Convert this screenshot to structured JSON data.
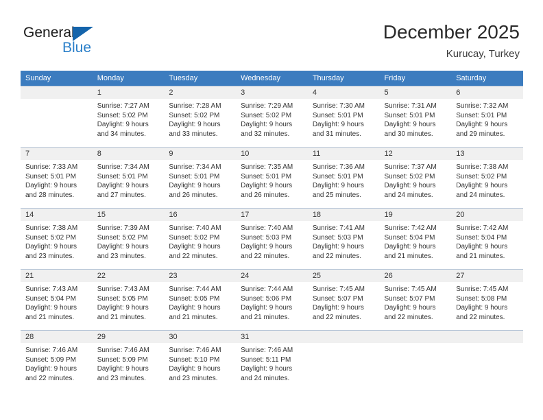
{
  "brand": {
    "name_part1": "General",
    "name_part2": "Blue",
    "triangle_color": "#1464ab",
    "blue_color": "#2a7fc9"
  },
  "header": {
    "title": "December 2025",
    "subtitle": "Kurucay, Turkey"
  },
  "theme": {
    "header_row_bg": "#3c7cbf",
    "daynum_bg": "#f0f0f0",
    "grid_line": "#b9c7d8",
    "text": "#333333"
  },
  "weekday_headers": [
    "Sunday",
    "Monday",
    "Tuesday",
    "Wednesday",
    "Thursday",
    "Friday",
    "Saturday"
  ],
  "weeks": [
    [
      {
        "day": "",
        "sunrise": "",
        "sunset": "",
        "daylight1": "",
        "daylight2": ""
      },
      {
        "day": "1",
        "sunrise": "Sunrise: 7:27 AM",
        "sunset": "Sunset: 5:02 PM",
        "daylight1": "Daylight: 9 hours",
        "daylight2": "and 34 minutes."
      },
      {
        "day": "2",
        "sunrise": "Sunrise: 7:28 AM",
        "sunset": "Sunset: 5:02 PM",
        "daylight1": "Daylight: 9 hours",
        "daylight2": "and 33 minutes."
      },
      {
        "day": "3",
        "sunrise": "Sunrise: 7:29 AM",
        "sunset": "Sunset: 5:02 PM",
        "daylight1": "Daylight: 9 hours",
        "daylight2": "and 32 minutes."
      },
      {
        "day": "4",
        "sunrise": "Sunrise: 7:30 AM",
        "sunset": "Sunset: 5:01 PM",
        "daylight1": "Daylight: 9 hours",
        "daylight2": "and 31 minutes."
      },
      {
        "day": "5",
        "sunrise": "Sunrise: 7:31 AM",
        "sunset": "Sunset: 5:01 PM",
        "daylight1": "Daylight: 9 hours",
        "daylight2": "and 30 minutes."
      },
      {
        "day": "6",
        "sunrise": "Sunrise: 7:32 AM",
        "sunset": "Sunset: 5:01 PM",
        "daylight1": "Daylight: 9 hours",
        "daylight2": "and 29 minutes."
      }
    ],
    [
      {
        "day": "7",
        "sunrise": "Sunrise: 7:33 AM",
        "sunset": "Sunset: 5:01 PM",
        "daylight1": "Daylight: 9 hours",
        "daylight2": "and 28 minutes."
      },
      {
        "day": "8",
        "sunrise": "Sunrise: 7:34 AM",
        "sunset": "Sunset: 5:01 PM",
        "daylight1": "Daylight: 9 hours",
        "daylight2": "and 27 minutes."
      },
      {
        "day": "9",
        "sunrise": "Sunrise: 7:34 AM",
        "sunset": "Sunset: 5:01 PM",
        "daylight1": "Daylight: 9 hours",
        "daylight2": "and 26 minutes."
      },
      {
        "day": "10",
        "sunrise": "Sunrise: 7:35 AM",
        "sunset": "Sunset: 5:01 PM",
        "daylight1": "Daylight: 9 hours",
        "daylight2": "and 26 minutes."
      },
      {
        "day": "11",
        "sunrise": "Sunrise: 7:36 AM",
        "sunset": "Sunset: 5:01 PM",
        "daylight1": "Daylight: 9 hours",
        "daylight2": "and 25 minutes."
      },
      {
        "day": "12",
        "sunrise": "Sunrise: 7:37 AM",
        "sunset": "Sunset: 5:02 PM",
        "daylight1": "Daylight: 9 hours",
        "daylight2": "and 24 minutes."
      },
      {
        "day": "13",
        "sunrise": "Sunrise: 7:38 AM",
        "sunset": "Sunset: 5:02 PM",
        "daylight1": "Daylight: 9 hours",
        "daylight2": "and 24 minutes."
      }
    ],
    [
      {
        "day": "14",
        "sunrise": "Sunrise: 7:38 AM",
        "sunset": "Sunset: 5:02 PM",
        "daylight1": "Daylight: 9 hours",
        "daylight2": "and 23 minutes."
      },
      {
        "day": "15",
        "sunrise": "Sunrise: 7:39 AM",
        "sunset": "Sunset: 5:02 PM",
        "daylight1": "Daylight: 9 hours",
        "daylight2": "and 23 minutes."
      },
      {
        "day": "16",
        "sunrise": "Sunrise: 7:40 AM",
        "sunset": "Sunset: 5:02 PM",
        "daylight1": "Daylight: 9 hours",
        "daylight2": "and 22 minutes."
      },
      {
        "day": "17",
        "sunrise": "Sunrise: 7:40 AM",
        "sunset": "Sunset: 5:03 PM",
        "daylight1": "Daylight: 9 hours",
        "daylight2": "and 22 minutes."
      },
      {
        "day": "18",
        "sunrise": "Sunrise: 7:41 AM",
        "sunset": "Sunset: 5:03 PM",
        "daylight1": "Daylight: 9 hours",
        "daylight2": "and 22 minutes."
      },
      {
        "day": "19",
        "sunrise": "Sunrise: 7:42 AM",
        "sunset": "Sunset: 5:04 PM",
        "daylight1": "Daylight: 9 hours",
        "daylight2": "and 21 minutes."
      },
      {
        "day": "20",
        "sunrise": "Sunrise: 7:42 AM",
        "sunset": "Sunset: 5:04 PM",
        "daylight1": "Daylight: 9 hours",
        "daylight2": "and 21 minutes."
      }
    ],
    [
      {
        "day": "21",
        "sunrise": "Sunrise: 7:43 AM",
        "sunset": "Sunset: 5:04 PM",
        "daylight1": "Daylight: 9 hours",
        "daylight2": "and 21 minutes."
      },
      {
        "day": "22",
        "sunrise": "Sunrise: 7:43 AM",
        "sunset": "Sunset: 5:05 PM",
        "daylight1": "Daylight: 9 hours",
        "daylight2": "and 21 minutes."
      },
      {
        "day": "23",
        "sunrise": "Sunrise: 7:44 AM",
        "sunset": "Sunset: 5:05 PM",
        "daylight1": "Daylight: 9 hours",
        "daylight2": "and 21 minutes."
      },
      {
        "day": "24",
        "sunrise": "Sunrise: 7:44 AM",
        "sunset": "Sunset: 5:06 PM",
        "daylight1": "Daylight: 9 hours",
        "daylight2": "and 21 minutes."
      },
      {
        "day": "25",
        "sunrise": "Sunrise: 7:45 AM",
        "sunset": "Sunset: 5:07 PM",
        "daylight1": "Daylight: 9 hours",
        "daylight2": "and 22 minutes."
      },
      {
        "day": "26",
        "sunrise": "Sunrise: 7:45 AM",
        "sunset": "Sunset: 5:07 PM",
        "daylight1": "Daylight: 9 hours",
        "daylight2": "and 22 minutes."
      },
      {
        "day": "27",
        "sunrise": "Sunrise: 7:45 AM",
        "sunset": "Sunset: 5:08 PM",
        "daylight1": "Daylight: 9 hours",
        "daylight2": "and 22 minutes."
      }
    ],
    [
      {
        "day": "28",
        "sunrise": "Sunrise: 7:46 AM",
        "sunset": "Sunset: 5:09 PM",
        "daylight1": "Daylight: 9 hours",
        "daylight2": "and 22 minutes."
      },
      {
        "day": "29",
        "sunrise": "Sunrise: 7:46 AM",
        "sunset": "Sunset: 5:09 PM",
        "daylight1": "Daylight: 9 hours",
        "daylight2": "and 23 minutes."
      },
      {
        "day": "30",
        "sunrise": "Sunrise: 7:46 AM",
        "sunset": "Sunset: 5:10 PM",
        "daylight1": "Daylight: 9 hours",
        "daylight2": "and 23 minutes."
      },
      {
        "day": "31",
        "sunrise": "Sunrise: 7:46 AM",
        "sunset": "Sunset: 5:11 PM",
        "daylight1": "Daylight: 9 hours",
        "daylight2": "and 24 minutes."
      },
      {
        "day": "",
        "sunrise": "",
        "sunset": "",
        "daylight1": "",
        "daylight2": ""
      },
      {
        "day": "",
        "sunrise": "",
        "sunset": "",
        "daylight1": "",
        "daylight2": ""
      },
      {
        "day": "",
        "sunrise": "",
        "sunset": "",
        "daylight1": "",
        "daylight2": ""
      }
    ]
  ]
}
